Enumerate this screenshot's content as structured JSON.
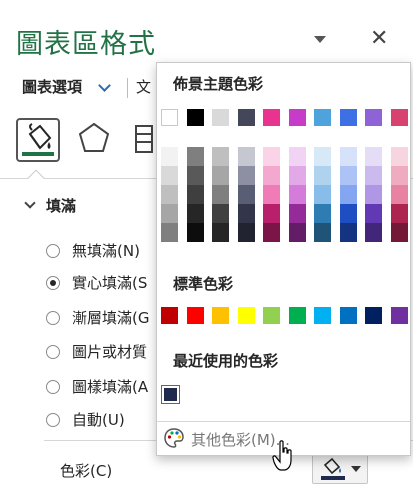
{
  "pane": {
    "title": "圖表區格式",
    "tab_options": "圖表選項",
    "tab_text_partial": "文"
  },
  "fill_section": {
    "heading": "填滿",
    "options": [
      {
        "label": "無填滿(N)",
        "selected": false
      },
      {
        "label": "實心填滿(S",
        "selected": true
      },
      {
        "label": "漸層填滿(G",
        "selected": false
      },
      {
        "label": "圖片或材質",
        "selected": false
      },
      {
        "label": "圖樣填滿(A",
        "selected": false
      },
      {
        "label": "自動(U)",
        "selected": false
      }
    ],
    "color_label": "色彩(C)",
    "current_color": "#1f2a4e"
  },
  "popup": {
    "theme_heading": "佈景主題色彩",
    "standard_heading": "標準色彩",
    "recent_heading": "最近使用的色彩",
    "more_colors_label": "其他色彩(M)...",
    "theme_top_row": [
      "#ffffff",
      "#000000",
      "#d9d9d9",
      "#44475a",
      "#e8348e",
      "#c63cc9",
      "#4fa3dd",
      "#3f6fe5",
      "#8e63d8",
      "#d8426f"
    ],
    "theme_shades": [
      [
        "#f2f2f2",
        "#7f7f7f",
        "#bfbfbf",
        "#c5c7d1",
        "#fad3e7",
        "#f1d3f3",
        "#d7e9f7",
        "#d6e1fa",
        "#e5dcf6",
        "#f7d5e0"
      ],
      [
        "#d9d9d9",
        "#595959",
        "#a6a6a6",
        "#8d90a3",
        "#f5a8cf",
        "#e3a8e7",
        "#afd3ef",
        "#adc3f5",
        "#cbbaee",
        "#efacc1"
      ],
      [
        "#bfbfbf",
        "#3f3f3f",
        "#7f7f7f",
        "#5a5e75",
        "#ef7cb7",
        "#d57cdb",
        "#87bde8",
        "#84a6f0",
        "#b097e6",
        "#e782a2"
      ],
      [
        "#a6a6a6",
        "#262626",
        "#404040",
        "#33354a",
        "#b8206c",
        "#952b99",
        "#2f7cb3",
        "#1e4ec2",
        "#6239b5",
        "#ad2451"
      ],
      [
        "#7f7f7f",
        "#0d0d0d",
        "#262626",
        "#222331",
        "#7b1548",
        "#631d66",
        "#1f5377",
        "#143481",
        "#412679",
        "#731836"
      ]
    ],
    "standard_colors": [
      "#c00000",
      "#ff0000",
      "#ffc000",
      "#ffff00",
      "#92d050",
      "#00b050",
      "#00b0f0",
      "#0070c0",
      "#002060",
      "#7030a0"
    ],
    "recent_colors": [
      "#1f2a4e"
    ]
  },
  "icons": {
    "fill_line": "paint-bucket-icon",
    "effects": "pentagon-icon",
    "size_properties": "size-properties-icon",
    "more_colors": "palette-icon",
    "fill_button": "paint-bucket-icon",
    "cursor": "mouse-cursor-icon"
  },
  "colors": {
    "title_green": "#217346"
  }
}
